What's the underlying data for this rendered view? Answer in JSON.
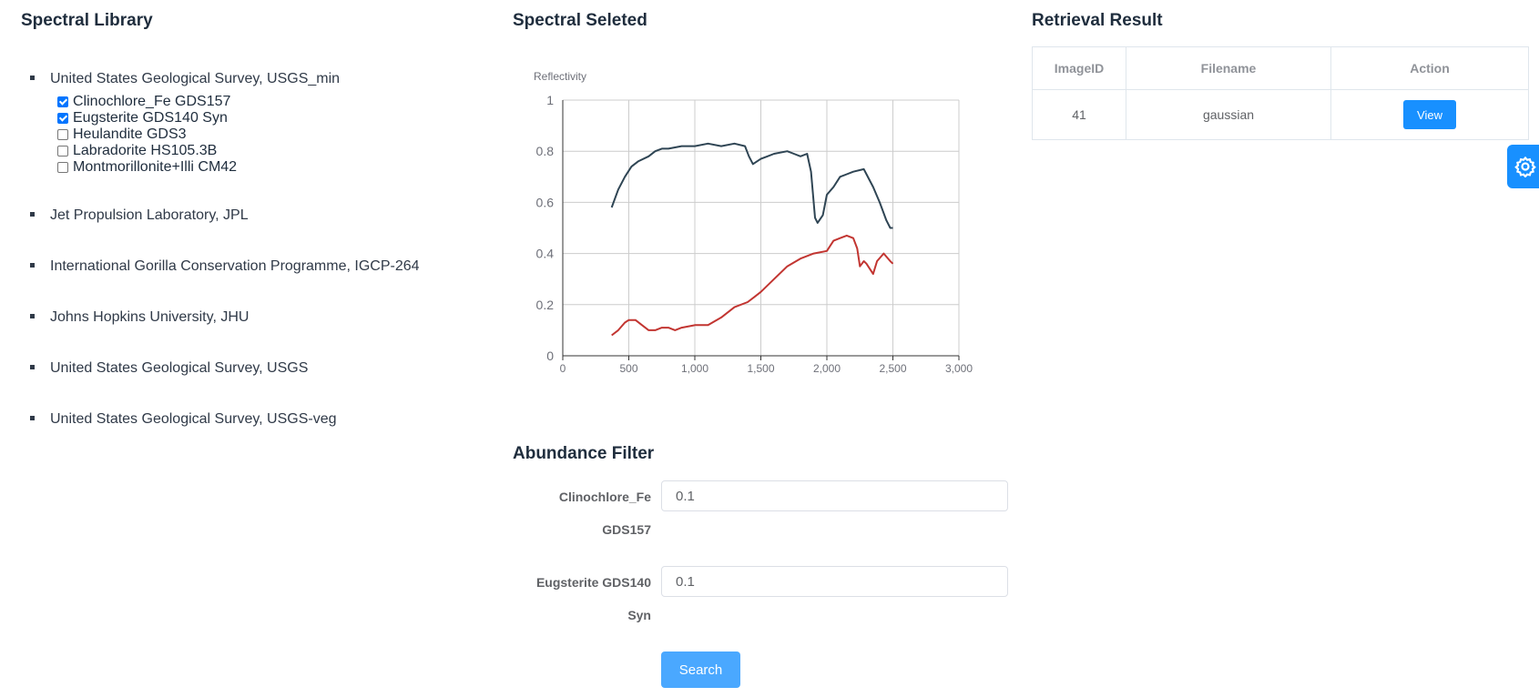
{
  "library": {
    "title": "Spectral Library",
    "sources": [
      {
        "label": "United States Geological Survey, USGS_min",
        "minerals": [
          {
            "label": "Clinochlore_Fe GDS157",
            "checked": true
          },
          {
            "label": "Eugsterite GDS140 Syn",
            "checked": true
          },
          {
            "label": "Heulandite GDS3",
            "checked": false
          },
          {
            "label": "Labradorite HS105.3B",
            "checked": false
          },
          {
            "label": "Montmorillonite+Illi CM42",
            "checked": false
          }
        ]
      },
      {
        "label": "Jet Propulsion Laboratory, JPL"
      },
      {
        "label": "International Gorilla Conservation Programme, IGCP-264"
      },
      {
        "label": "Johns Hopkins University, JHU"
      },
      {
        "label": "United States Geological Survey, USGS"
      },
      {
        "label": "United States Geological Survey, USGS-veg"
      }
    ]
  },
  "selected": {
    "title": "Spectral Seleted"
  },
  "chart_data": {
    "type": "line",
    "title": "",
    "xlabel": "",
    "ylabel": "Reflectivity",
    "xlim": [
      0,
      3000
    ],
    "ylim": [
      0,
      1
    ],
    "xticks": [
      "0",
      "500",
      "1,000",
      "1,500",
      "2,000",
      "2,500",
      "3,000"
    ],
    "yticks": [
      "0",
      "0.2",
      "0.4",
      "0.6",
      "0.8",
      "1"
    ],
    "grid": true,
    "series": [
      {
        "name": "Clinochlore_Fe GDS157",
        "color": "#2f4554",
        "x": [
          370,
          420,
          470,
          520,
          570,
          650,
          700,
          750,
          800,
          900,
          1000,
          1100,
          1200,
          1300,
          1380,
          1410,
          1440,
          1500,
          1550,
          1600,
          1700,
          1750,
          1800,
          1850,
          1880,
          1910,
          1930,
          1970,
          2000,
          2050,
          2100,
          2150,
          2200,
          2280,
          2300,
          2350,
          2400,
          2450,
          2480,
          2500
        ],
        "y": [
          0.58,
          0.65,
          0.7,
          0.74,
          0.76,
          0.78,
          0.8,
          0.81,
          0.81,
          0.82,
          0.82,
          0.83,
          0.82,
          0.83,
          0.82,
          0.78,
          0.75,
          0.77,
          0.78,
          0.79,
          0.8,
          0.79,
          0.78,
          0.79,
          0.72,
          0.54,
          0.52,
          0.55,
          0.63,
          0.66,
          0.7,
          0.71,
          0.72,
          0.73,
          0.71,
          0.66,
          0.6,
          0.53,
          0.5,
          0.5
        ]
      },
      {
        "name": "Eugsterite GDS140 Syn",
        "color": "#c23531",
        "x": [
          370,
          420,
          470,
          500,
          550,
          600,
          650,
          700,
          750,
          800,
          850,
          900,
          1000,
          1100,
          1200,
          1300,
          1400,
          1450,
          1500,
          1600,
          1700,
          1800,
          1900,
          2000,
          2050,
          2100,
          2150,
          2200,
          2230,
          2250,
          2280,
          2300,
          2350,
          2380,
          2430,
          2480,
          2500
        ],
        "y": [
          0.08,
          0.1,
          0.13,
          0.14,
          0.14,
          0.12,
          0.1,
          0.1,
          0.11,
          0.11,
          0.1,
          0.11,
          0.12,
          0.12,
          0.15,
          0.19,
          0.21,
          0.23,
          0.25,
          0.3,
          0.35,
          0.38,
          0.4,
          0.41,
          0.45,
          0.46,
          0.47,
          0.46,
          0.42,
          0.35,
          0.37,
          0.36,
          0.32,
          0.37,
          0.4,
          0.37,
          0.36
        ]
      }
    ]
  },
  "abundance": {
    "title": "Abundance Filter",
    "fields": [
      {
        "label_line1": "Clinochlore_Fe",
        "label_line2": "GDS157",
        "value": "0.1"
      },
      {
        "label_line1": "Eugsterite GDS140",
        "label_line2": "Syn",
        "value": "0.1"
      }
    ],
    "search_label": "Search"
  },
  "retrieval": {
    "title": "Retrieval Result",
    "columns": [
      "ImageID",
      "Filename",
      "Action"
    ],
    "rows": [
      {
        "id": "41",
        "filename": "gaussian",
        "action": "View"
      }
    ]
  },
  "settings": {
    "icon": "gear-icon"
  }
}
